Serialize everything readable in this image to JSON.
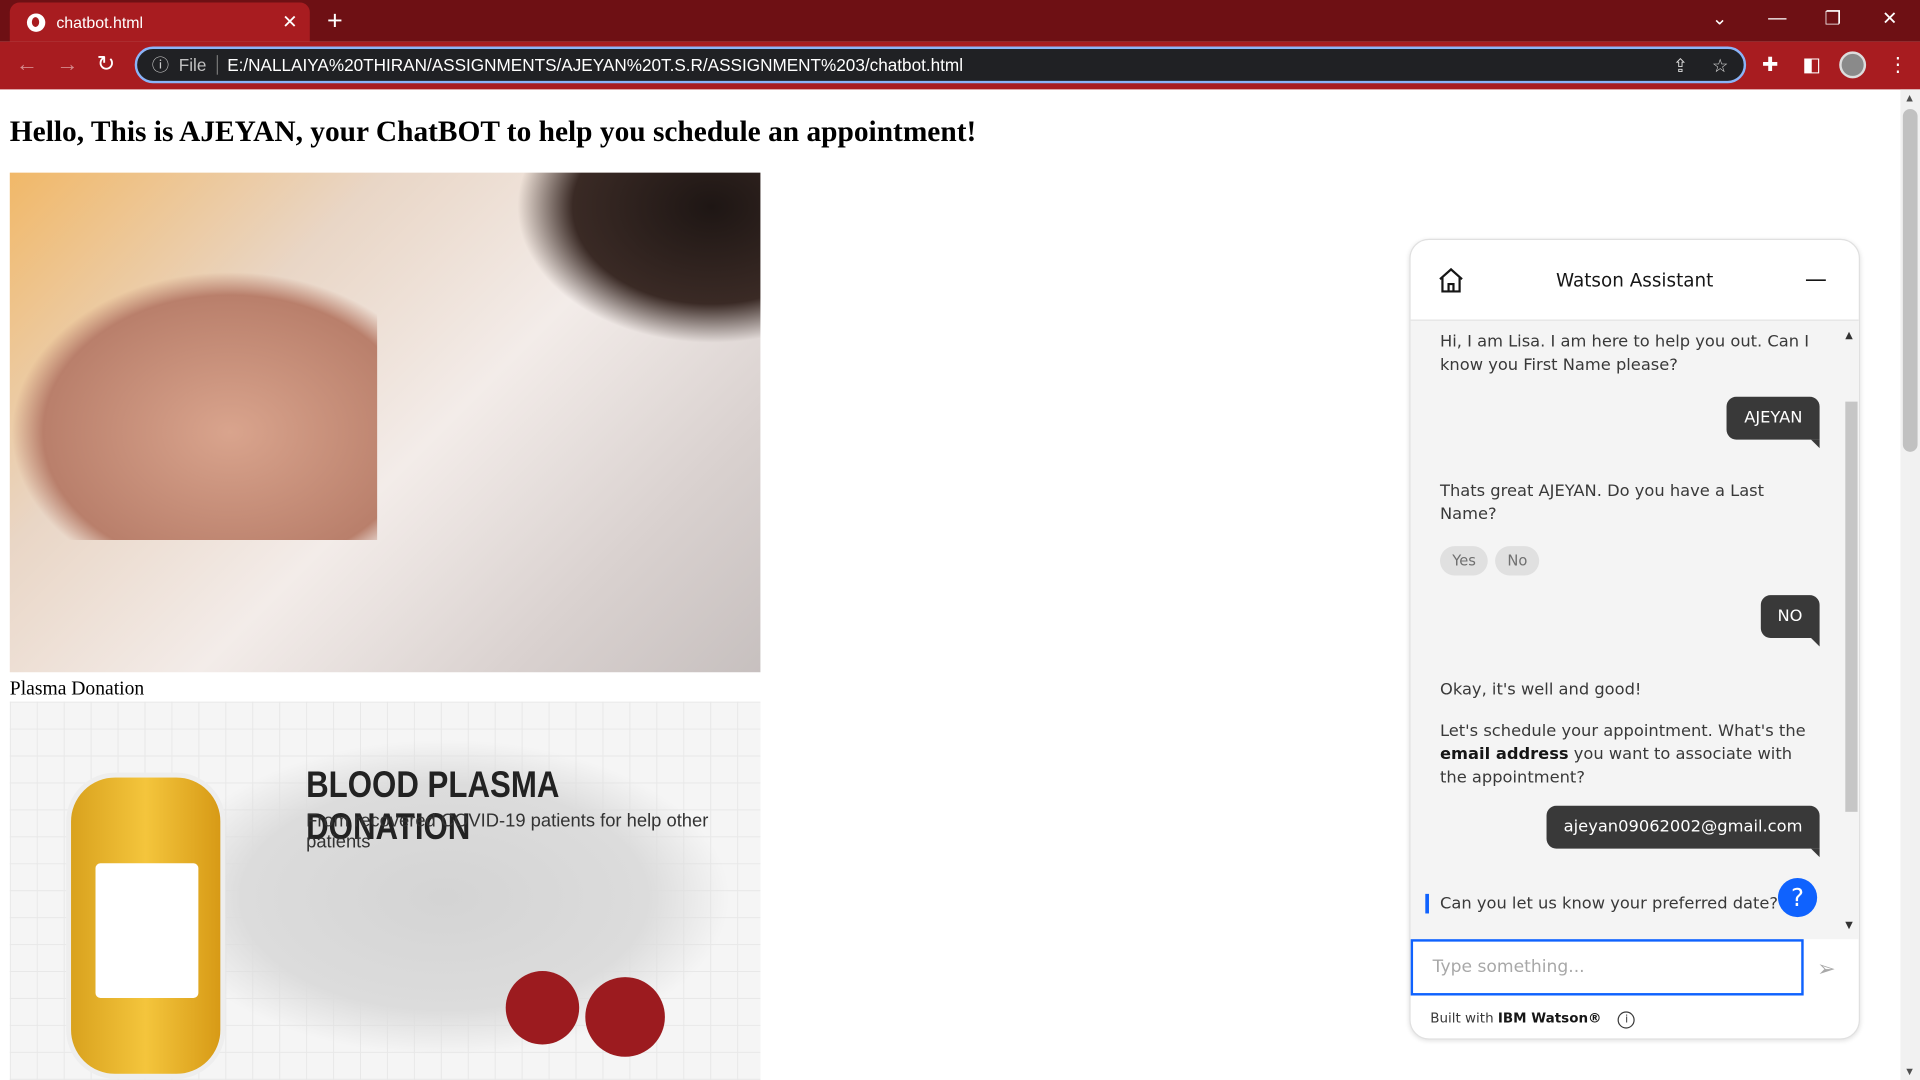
{
  "browser": {
    "tab_title": "chatbot.html",
    "new_tab": "+",
    "url_scheme_label": "File",
    "url": "E:/NALLAIYA%20THIRAN/ASSIGNMENTS/AJEYAN%20T.S.R/ASSIGNMENT%203/chatbot.html",
    "colors": {
      "tab_bar": "#6e1014",
      "toolbar": "#a81c20",
      "omnibox": "#202124"
    }
  },
  "page": {
    "heading": "Hello, This is AJEYAN, your ChatBOT to help you schedule an appointment!",
    "image1_caption": "Plasma Donation",
    "image2_title": "BLOOD PLASMA DONATION",
    "image2_subtitle": "From recovered COVID-19 patients for help other patients"
  },
  "chat": {
    "title": "Watson Assistant",
    "messages": [
      {
        "from": "bot",
        "text": "Hi, I am Lisa. I am here to help you out. Can I know you First Name please?"
      },
      {
        "from": "user",
        "text": "AJEYAN"
      },
      {
        "from": "bot",
        "text": "Thats great AJEYAN. Do you have a Last Name?"
      },
      {
        "from": "user",
        "text": "NO"
      },
      {
        "from": "bot",
        "text": "Okay, it's well and good!"
      },
      {
        "from": "bot",
        "text_before": "Let's schedule your appointment. What's the ",
        "bold": "email address",
        "text_after": " you want to associate with the appointment?"
      },
      {
        "from": "user",
        "text": "ajeyan09062002@gmail.com"
      },
      {
        "from": "bot",
        "text": "Can you let us know your preferred date?"
      }
    ],
    "options": [
      "Yes",
      "No"
    ],
    "input_placeholder": "Type something...",
    "footer_prefix": "Built with ",
    "footer_brand": "IBM Watson®",
    "help_label": "?",
    "accent": "#0f62fe"
  }
}
